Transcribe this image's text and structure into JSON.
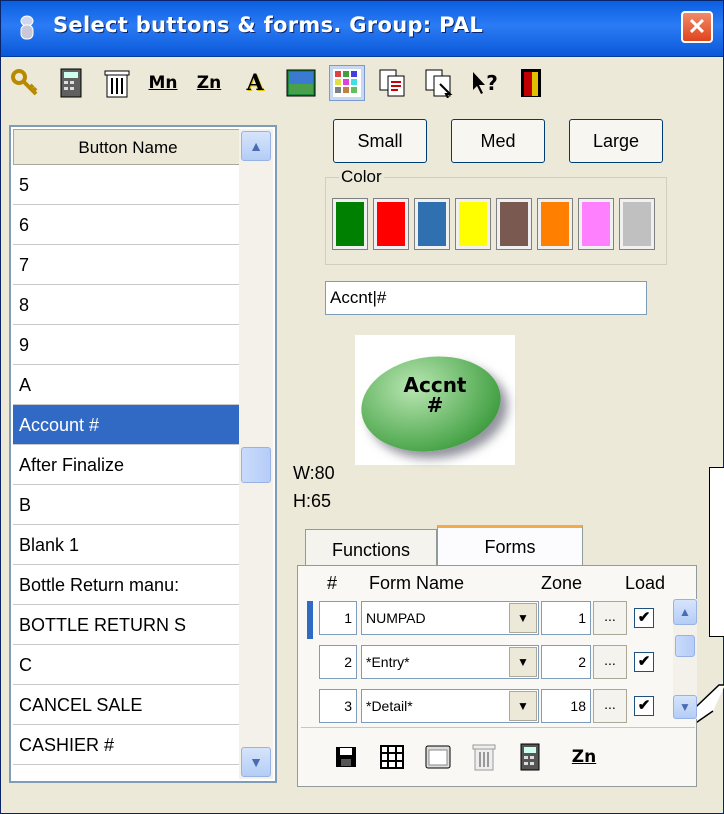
{
  "window": {
    "title": "Select buttons & forms.  Group: PAL",
    "close": "✕"
  },
  "toolbar": {
    "mn": "Mn",
    "zn": "Zn",
    "a": "A",
    "help": "?"
  },
  "button_list": {
    "header": "Button Name",
    "items": [
      "5",
      "6",
      "7",
      "8",
      "9",
      "A",
      "Account #",
      "After Finalize",
      "B",
      "Blank 1",
      "Bottle Return manu:",
      "BOTTLE RETURN S",
      "C",
      "CANCEL SALE",
      "CASHIER #"
    ],
    "selected": "Account #"
  },
  "size_buttons": {
    "small": "Small",
    "med": "Med",
    "large": "Large"
  },
  "color": {
    "label": "Color",
    "swatches": [
      "#008000",
      "#ff0000",
      "#3070b0",
      "#ffff00",
      "#7a5a50",
      "#ff8000",
      "#ff80ff",
      "#c0c0c0"
    ]
  },
  "button_text": "Accnt|#",
  "preview": {
    "line1": "Accnt",
    "line2": "#"
  },
  "dimensions": {
    "w": "W:80",
    "h": "H:65"
  },
  "tabs": {
    "functions": "Functions",
    "forms": "Forms"
  },
  "forms_table": {
    "headers": {
      "num": "#",
      "name": "Form Name",
      "zone": "Zone",
      "load": "Load"
    },
    "rows": [
      {
        "num": "1",
        "name": "NUMPAD",
        "zone": "1",
        "dots": "...",
        "load": "✔"
      },
      {
        "num": "2",
        "name": "*Entry*",
        "zone": "2",
        "dots": "...",
        "load": "✔"
      },
      {
        "num": "3",
        "name": "*Detail*",
        "zone": "18",
        "dots": "...",
        "load": "✔"
      }
    ]
  },
  "bottom_toolbar": {
    "zn": "Zn"
  }
}
